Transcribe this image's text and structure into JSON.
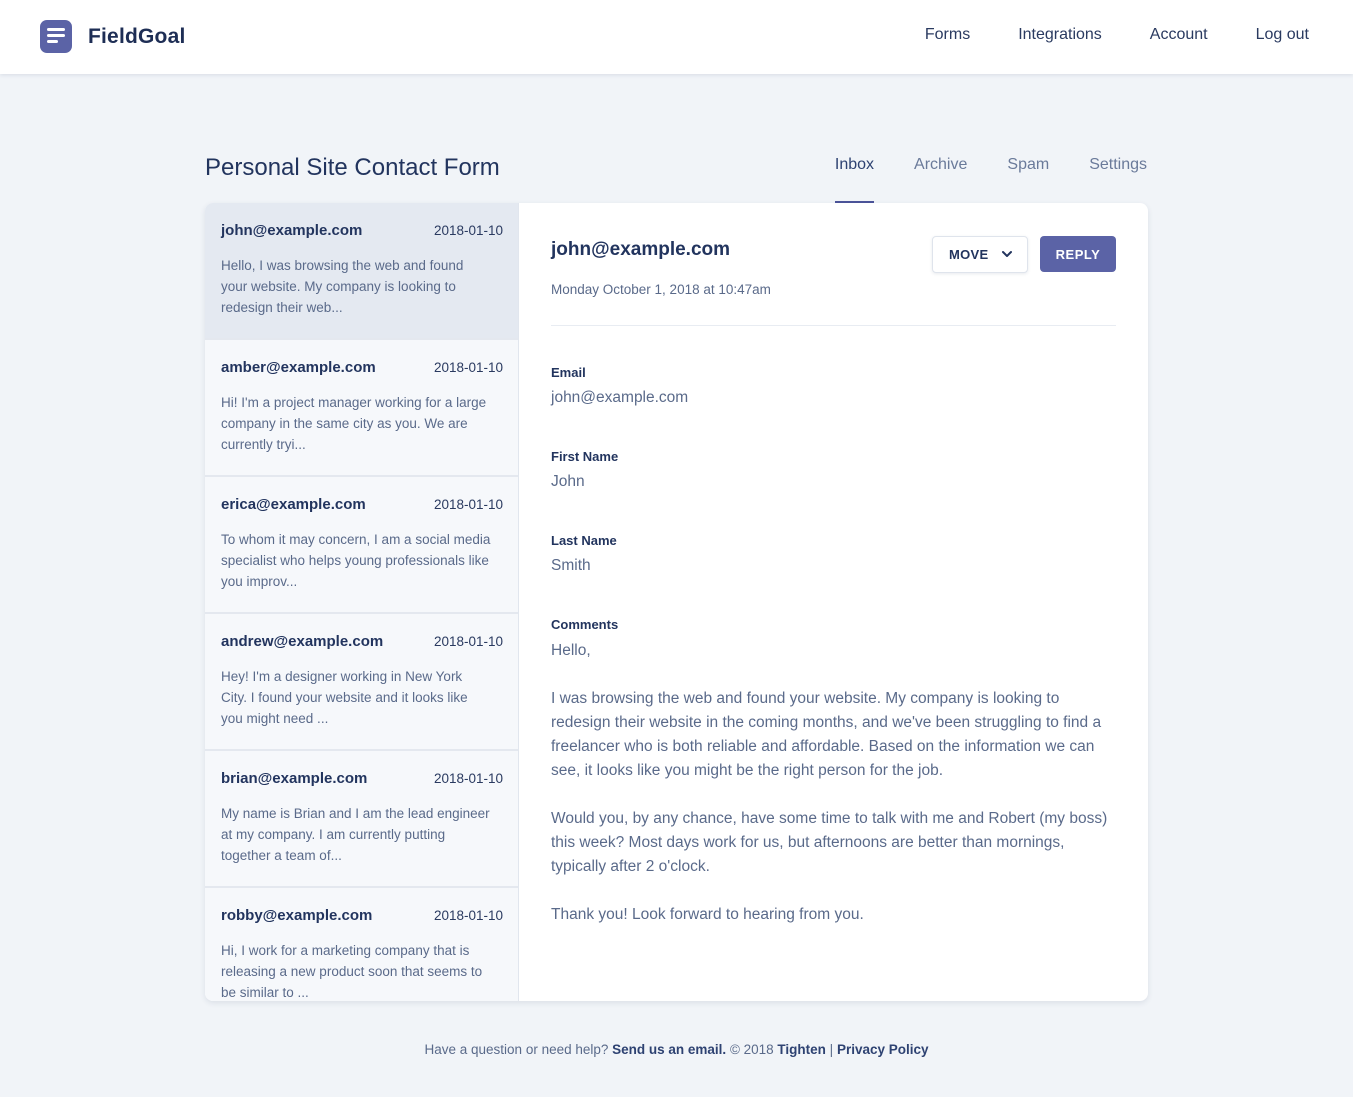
{
  "brand": {
    "name": "FieldGoal",
    "accent": "#5b63a6"
  },
  "nav": {
    "items": [
      "Forms",
      "Integrations",
      "Account",
      "Log out"
    ]
  },
  "form": {
    "title": "Personal Site Contact Form"
  },
  "tabs": [
    {
      "label": "Inbox",
      "active": true
    },
    {
      "label": "Archive",
      "active": false
    },
    {
      "label": "Spam",
      "active": false
    },
    {
      "label": "Settings",
      "active": false
    }
  ],
  "submissions": [
    {
      "email": "john@example.com",
      "date": "2018-01-10",
      "preview": "Hello,  I was browsing the web and found your website. My company is looking to redesign their web...",
      "active": true
    },
    {
      "email": "amber@example.com",
      "date": "2018-01-10",
      "preview": "Hi! I'm a project manager working for a large company in the same city as you. We are currently tryi...",
      "active": false
    },
    {
      "email": "erica@example.com",
      "date": "2018-01-10",
      "preview": "To whom it may concern, I am a social media specialist who helps young professionals like you improv...",
      "active": false
    },
    {
      "email": "andrew@example.com",
      "date": "2018-01-10",
      "preview": "Hey! I'm a designer working in New York City. I found your website and it looks like you might need ...",
      "active": false
    },
    {
      "email": "brian@example.com",
      "date": "2018-01-10",
      "preview": "My name is Brian and I am the lead engineer at my company. I am currently putting together a team of...",
      "active": false
    },
    {
      "email": "robby@example.com",
      "date": "2018-01-10",
      "preview": "Hi, I work for a marketing company that is releasing a new product soon that seems to be similar to ...",
      "active": false
    }
  ],
  "detail": {
    "email": "john@example.com",
    "received": "Monday October 1, 2018 at 10:47am",
    "move_label": "MOVE",
    "reply_label": "REPLY",
    "fields": [
      {
        "label": "Email",
        "value": "john@example.com"
      },
      {
        "label": "First Name",
        "value": "John"
      },
      {
        "label": "Last Name",
        "value": "Smith"
      }
    ],
    "comments": {
      "label": "Comments",
      "paragraphs": [
        "Hello,",
        "I was browsing the web and found your website. My company is looking to redesign their website in the coming months, and we've been struggling to find a freelancer who is both reliable and affordable. Based on the information we can see, it looks like you might be the right person for the job.",
        "Would you, by any chance, have some time to talk with me and Robert (my boss) this week? Most days work for us, but afternoons are better than mornings, typically after 2 o'clock.",
        "Thank you! Look forward to hearing from you."
      ]
    }
  },
  "footer": {
    "question": "Have a question or need help? ",
    "email_link": "Send us an email.",
    "copyright": " © 2018 ",
    "company_link": "Tighten",
    "separator": " | ",
    "privacy_link": "Privacy Policy"
  }
}
